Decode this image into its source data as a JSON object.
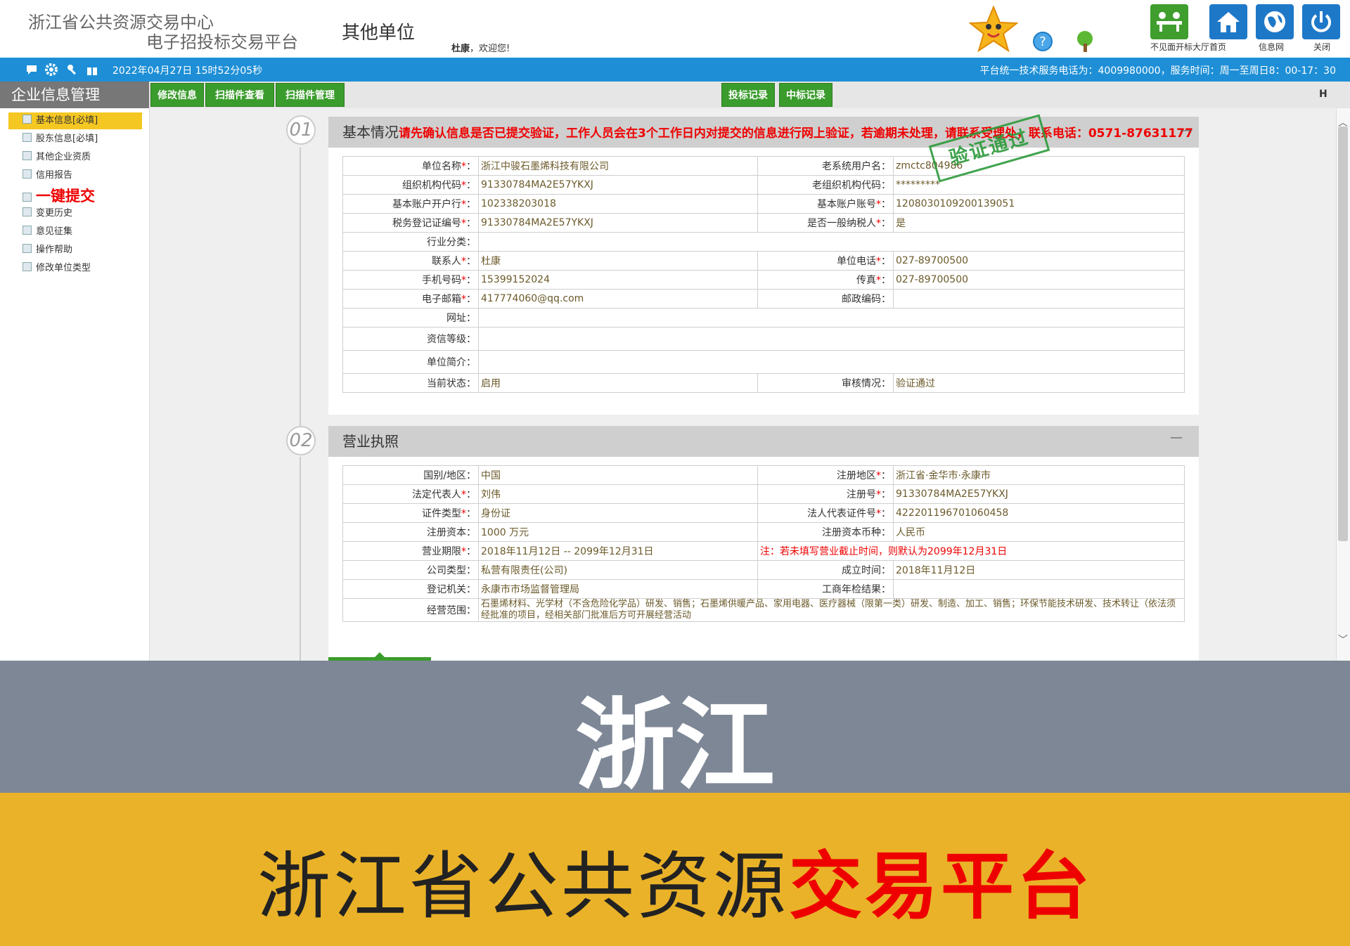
{
  "header": {
    "center_name": "浙江省公共资源交易中心",
    "platform_name": "电子招投标交易平台",
    "unit_type": "其他单位",
    "user_name": "杜康",
    "welcome_text": "，欢迎您!",
    "buttons": [
      {
        "label": "不见面开标大厅首页",
        "icon": "meeting-icon",
        "color": "#3f9e2e"
      },
      {
        "label": "",
        "icon": "home-icon",
        "color": "#1e78c8"
      },
      {
        "label": "信息网",
        "icon": "globe-icon",
        "color": "#1e78c8"
      },
      {
        "label": "关闭",
        "icon": "power-icon",
        "color": "#1e78c8"
      }
    ]
  },
  "bluebar": {
    "datetime": "2022年04月27日 15时52分05秒",
    "service_text": "平台统一技术服务电话为：4009980000，服务时间：周一至周日8：00-17：30"
  },
  "sidebar": {
    "title": "企业信息管理",
    "items": [
      {
        "label": "基本信息[必填]",
        "active": true
      },
      {
        "label": "股东信息[必填]"
      },
      {
        "label": "其他企业资质"
      },
      {
        "label": "信用报告"
      },
      {
        "label": "一键提交",
        "big": true
      },
      {
        "label": "变更历史"
      },
      {
        "label": "意见征集"
      },
      {
        "label": "操作帮助"
      },
      {
        "label": "修改单位类型"
      }
    ]
  },
  "tabs": {
    "left": [
      "修改信息",
      "扫描件查看",
      "扫描件管理"
    ],
    "right": [
      "投标记录",
      "中标记录"
    ]
  },
  "section1": {
    "num": "01",
    "title": "基本情况",
    "warning": "请先确认信息是否已提交验证，工作人员会在3个工作日内对提交的信息进行网上验证，若逾期未处理，请联系受理处，联系电话：0571-87631177",
    "stamp": "验证通过",
    "rows": [
      {
        "l1": "单位名称",
        "r1": true,
        "v1": "浙江中骏石墨烯科技有限公司",
        "l2": "老系统用户名",
        "r2": false,
        "v2": "zmctc804986"
      },
      {
        "l1": "组织机构代码",
        "r1": true,
        "v1": "91330784MA2E57YKXJ",
        "l2": "老组织机构代码",
        "r2": false,
        "v2": "*********"
      },
      {
        "l1": "基本账户开户行",
        "r1": true,
        "v1": "102338203018",
        "l2": "基本账户账号",
        "r2": true,
        "v2": "1208030109200139051"
      },
      {
        "l1": "税务登记证编号",
        "r1": true,
        "v1": "91330784MA2E57YKXJ",
        "l2": "是否一般纳税人",
        "r2": true,
        "v2": "是"
      },
      {
        "l1": "行业分类",
        "r1": false,
        "v1": "",
        "full": true
      },
      {
        "l1": "联系人",
        "r1": true,
        "v1": "杜康",
        "l2": "单位电话",
        "r2": true,
        "v2": "027-89700500"
      },
      {
        "l1": "手机号码",
        "r1": true,
        "v1": "15399152024",
        "l2": "传真",
        "r2": true,
        "v2": "027-89700500"
      },
      {
        "l1": "电子邮箱",
        "r1": true,
        "v1": "417774060@qq.com",
        "l2": "邮政编码",
        "r2": false,
        "v2": ""
      },
      {
        "l1": "网址",
        "r1": false,
        "v1": "",
        "full": true
      },
      {
        "l1": "资信等级",
        "r1": false,
        "v1": "",
        "full": true,
        "tall": true
      },
      {
        "l1": "单位简介",
        "r1": false,
        "v1": "",
        "full": true,
        "tall": true
      },
      {
        "l1": "当前状态",
        "r1": false,
        "v1": "启用",
        "l2": "审核情况",
        "r2": false,
        "v2": "验证通过"
      }
    ]
  },
  "section2": {
    "num": "02",
    "title": "营业执照",
    "rows": [
      {
        "l1": "国别/地区",
        "r1": false,
        "v1": "中国",
        "l2": "注册地区",
        "r2": true,
        "v2": "浙江省·金华市·永康市"
      },
      {
        "l1": "法定代表人",
        "r1": true,
        "v1": "刘伟",
        "l2": "注册号",
        "r2": true,
        "v2": "91330784MA2E57YKXJ"
      },
      {
        "l1": "证件类型",
        "r1": true,
        "v1": "身份证",
        "l2": "法人代表证件号",
        "r2": true,
        "v2": "422201196701060458"
      },
      {
        "l1": "注册资本",
        "r1": false,
        "v1": "1000 万元",
        "l2": "注册资本币种",
        "r2": false,
        "v2": "人民币"
      },
      {
        "l1": "营业期限",
        "r1": true,
        "v1": "2018年11月12日 -- 2099年12月31日",
        "note": "注：若未填写营业截止时间，则默认为2099年12月31日"
      },
      {
        "l1": "公司类型",
        "r1": false,
        "v1": "私营有限责任(公司)",
        "l2": "成立时间",
        "r2": false,
        "v2": "2018年11月12日"
      },
      {
        "l1": "登记机关",
        "r1": false,
        "v1": "永康市市场监督管理局",
        "l2": "工商年检结果",
        "r2": false,
        "v2": ""
      },
      {
        "l1": "经营范围",
        "r1": false,
        "v1": "石墨烯材料、光学材（不含危险化学品）研发、销售；石墨烯供暖产品、家用电器、医疗器械（限第一类）研发、制造、加工、销售；环保节能技术研发、技术转让（依法须经批准的项目，经相关部门批准后方可开展经营活动",
        "full": true,
        "tall": true
      }
    ]
  },
  "banner": {
    "region": "浙江",
    "footer_dark": "浙江省公共资源",
    "footer_red": "交易平台"
  }
}
